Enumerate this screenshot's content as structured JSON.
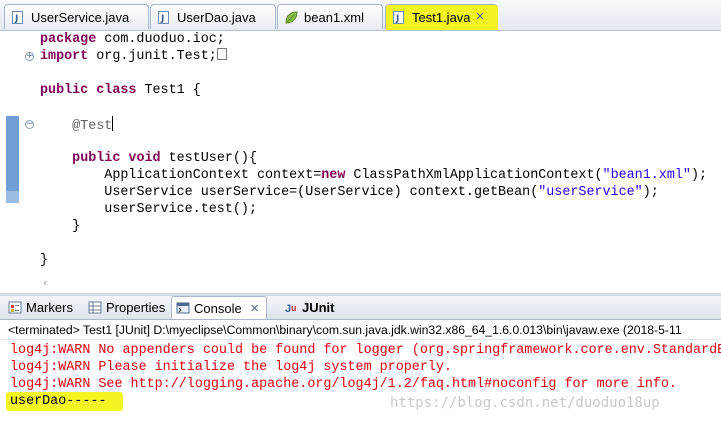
{
  "editor_tabs": [
    {
      "label": "UserService.java",
      "icon": "java-file-icon"
    },
    {
      "label": "UserDao.java",
      "icon": "java-file-icon"
    },
    {
      "label": "bean1.xml",
      "icon": "xml-file-icon"
    },
    {
      "label": "Test1.java",
      "icon": "java-file-icon",
      "active": true
    }
  ],
  "code": {
    "l1_kw": "package",
    "l1_rest": " com.duoduo.ioc;",
    "l2_kw": "import",
    "l2_rest": " org.junit.Test;",
    "l4_kw1": "public",
    "l4_kw2": "class",
    "l4_rest": " Test1 {",
    "l6_anno": "@Test",
    "l8_kw1": "public",
    "l8_kw2": "void",
    "l8_rest": " testUser(){",
    "l9_a": "ApplicationContext context=",
    "l9_kw": "new",
    "l9_b": " ClassPathXmlApplicationContext(",
    "l9_str": "\"bean1.xml\"",
    "l9_c": ");",
    "l10_a": "UserService userService=(UserService) context.getBean(",
    "l10_str": "\"userService\"",
    "l10_c": ");",
    "l11": "userService.test();",
    "l12": "}",
    "l14": "}"
  },
  "view_tabs": [
    {
      "label": "Markers"
    },
    {
      "label": "Properties"
    },
    {
      "label": "Console",
      "active": true,
      "close": "✕"
    },
    {
      "label": "JUnit"
    }
  ],
  "console": {
    "header": "<terminated> Test1 [JUnit] D:\\myeclipse\\Common\\binary\\com.sun.java.jdk.win32.x86_64_1.6.0.013\\bin\\javaw.exe (2018-5-11",
    "lines": [
      "log4j:WARN No appenders could be found for logger (org.springframework.core.env.StandardE",
      "log4j:WARN Please initialize the log4j system properly.",
      "log4j:WARN See http://logging.apache.org/log4j/1.2/faq.html#noconfig for more info.",
      "userDao-----"
    ]
  },
  "watermark": "https://blog.csdn.net/duoduo18up",
  "colors": {
    "keyword": "#7f0055",
    "string": "#2a00ff",
    "annotation": "#646464",
    "console_error": "#e0000f",
    "highlight": "#f3f523"
  }
}
